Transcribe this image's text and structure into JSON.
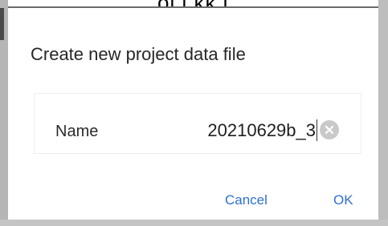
{
  "background": {
    "cutoff_text": "ol.l.kk l"
  },
  "dialog": {
    "title": "Create new project data file",
    "field": {
      "label": "Name",
      "value": "20210629b_3"
    },
    "buttons": {
      "cancel": "Cancel",
      "ok": "OK"
    }
  },
  "colors": {
    "accent": "#2f6fcf",
    "clear_icon": "#c9c9c9"
  },
  "icons": {
    "clear": "clear-text-icon"
  }
}
